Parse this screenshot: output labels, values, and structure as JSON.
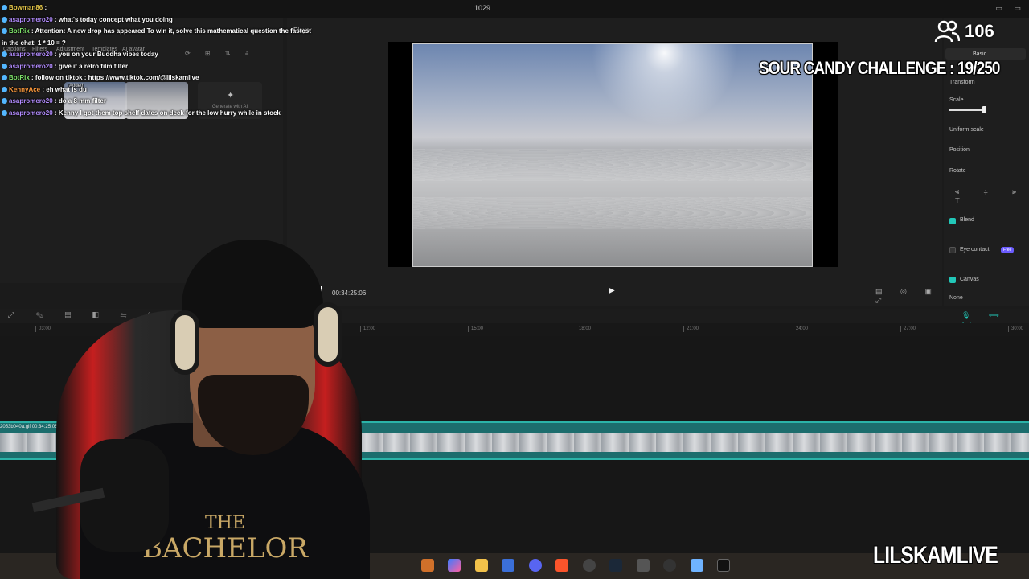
{
  "window": {
    "title": "1029"
  },
  "media_panel": {
    "tabs": [
      "Captions",
      "Filters",
      "Adjustment",
      "Templates",
      "AI avatar"
    ],
    "thumb_badge": "Added",
    "generate_label": "Generate with AI"
  },
  "chat": [
    {
      "user": "Bowman86",
      "msg": "",
      "color": "yellow"
    },
    {
      "user": "asapromero20",
      "msg": "what's today concept what you doing",
      "color": "purple"
    },
    {
      "user": "BotRix",
      "msg": "Attention: A new drop has appeared   To win it, solve this mathematical question the fastest",
      "color": "green"
    },
    {
      "user": "",
      "msg": "in the chat: 1 * 10 = ?",
      "color": "none"
    },
    {
      "user": "asapromero20",
      "msg": "you on your Buddha vibes today",
      "color": "purple"
    },
    {
      "user": "asapromero20",
      "msg": "give it a retro film filter",
      "color": "purple"
    },
    {
      "user": "BotRix",
      "msg": "follow on tiktok : https://www.tiktok.com/@lilskamlive",
      "color": "green"
    },
    {
      "user": "KennyAce",
      "msg": "eh what is du",
      "color": "orange"
    },
    {
      "user": "asapromero20",
      "msg": "do a 8 mm filter",
      "color": "purple"
    },
    {
      "user": "asapromero20",
      "msg": "Kenny I got them top shelf dates on deck for the low hurry while in stock",
      "color": "purple"
    }
  ],
  "player": {
    "label": "Player",
    "timecode": "00:34:25:06",
    "play_icon": "play-icon"
  },
  "overlay": {
    "viewer_count": "106",
    "challenge": "SOUR CANDY CHALLENGE : 19/250",
    "watermark": "LILSKAMLIVE"
  },
  "inspector": {
    "tab_basic": "Basic",
    "transform": "Transform",
    "scale": "Scale",
    "uniform_scale": "Uniform scale",
    "position": "Position",
    "rotate": "Rotate",
    "blend": "Blend",
    "eye_contact": "Eye contact",
    "free_badge": "Free",
    "canvas": "Canvas",
    "canvas_value": "None"
  },
  "timeline": {
    "ticks": [
      "03:00",
      "12:00",
      "15:00",
      "18:00",
      "21:00",
      "24:00",
      "27:00",
      "30:00"
    ],
    "clip_label": "2053b040a.gif   00:34:25:06",
    "accent": "#22c7b8"
  },
  "shirt": {
    "line1": "THE",
    "line2": "BACHELOR"
  }
}
